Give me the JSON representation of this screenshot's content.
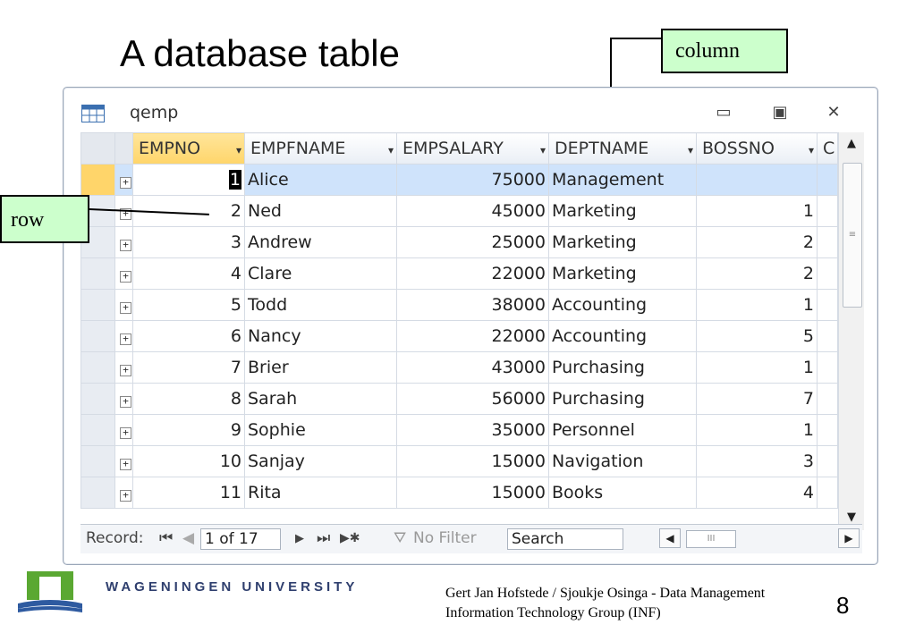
{
  "slide": {
    "title": "A database table",
    "page_number": "8"
  },
  "callouts": {
    "column": "column",
    "row": "row"
  },
  "window": {
    "title": "qemp",
    "table_icon": "table-icon",
    "minimize_icon": "minimize-icon",
    "restore_icon": "restore-icon",
    "close_icon": "close-icon"
  },
  "grid": {
    "columns": [
      "EMPNO",
      "EMPFNAME",
      "EMPSALARY",
      "DEPTNAME",
      "BOSSNO",
      "C"
    ],
    "rows": [
      [
        "1",
        "Alice",
        "75000",
        "Management",
        ""
      ],
      [
        "2",
        "Ned",
        "45000",
        "Marketing",
        "1"
      ],
      [
        "3",
        "Andrew",
        "25000",
        "Marketing",
        "2"
      ],
      [
        "4",
        "Clare",
        "22000",
        "Marketing",
        "2"
      ],
      [
        "5",
        "Todd",
        "38000",
        "Accounting",
        "1"
      ],
      [
        "6",
        "Nancy",
        "22000",
        "Accounting",
        "5"
      ],
      [
        "7",
        "Brier",
        "43000",
        "Purchasing",
        "1"
      ],
      [
        "8",
        "Sarah",
        "56000",
        "Purchasing",
        "7"
      ],
      [
        "9",
        "Sophie",
        "35000",
        "Personnel",
        "1"
      ],
      [
        "10",
        "Sanjay",
        "15000",
        "Navigation",
        "3"
      ],
      [
        "11",
        "Rita",
        "15000",
        "Books",
        "4"
      ]
    ],
    "expander": "+",
    "sort_arrow": "▾"
  },
  "navigator": {
    "record_label": "Record:",
    "first": "⏮",
    "prev": "◀",
    "position": "1 of 17",
    "next": "▶",
    "last": "⏭",
    "new": "▶✱",
    "filter": "No Filter",
    "search": "Search"
  },
  "footer": {
    "university": "WAGENINGEN UNIVERSITY",
    "credit_line1": "Gert Jan Hofstede / Sjoukje Osinga - Data Management",
    "credit_line2": "Information Technology Group (INF)"
  },
  "colors": {
    "header_selected": "#ffd56a",
    "row_selected": "#cfe3fb",
    "logo_green": "#5aa832",
    "logo_blue": "#2e5aa0"
  }
}
